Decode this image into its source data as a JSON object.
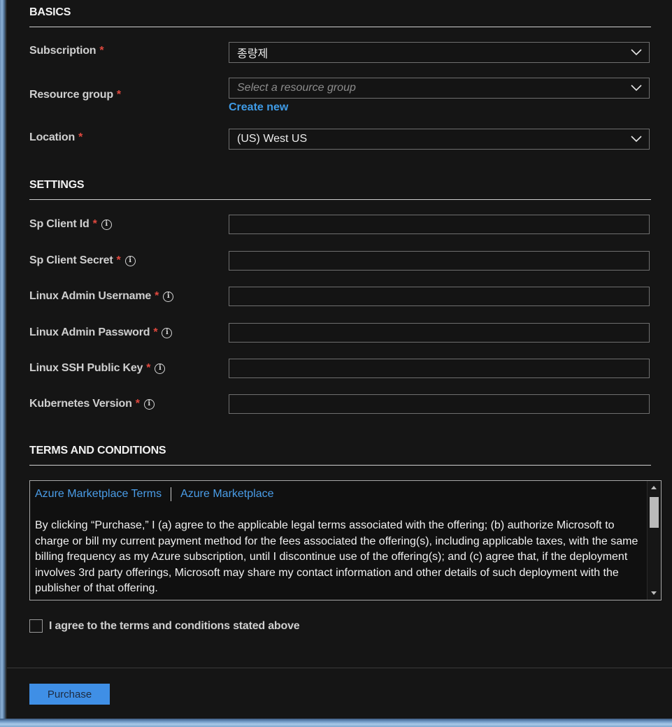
{
  "basics": {
    "title": "BASICS",
    "subscription": {
      "label": "Subscription",
      "value": "종량제"
    },
    "resource_group": {
      "label": "Resource group",
      "placeholder": "Select a resource group",
      "create_new": "Create new"
    },
    "location": {
      "label": "Location",
      "value": "(US) West US"
    }
  },
  "settings": {
    "title": "SETTINGS",
    "sp_client_id": {
      "label": "Sp Client Id"
    },
    "sp_client_secret": {
      "label": "Sp Client Secret"
    },
    "linux_admin_username": {
      "label": "Linux Admin Username"
    },
    "linux_admin_password": {
      "label": "Linux Admin Password"
    },
    "linux_ssh_public_key": {
      "label": "Linux SSH Public Key"
    },
    "kubernetes_version": {
      "label": "Kubernetes Version"
    }
  },
  "required_mark": "*",
  "info_glyph": "i",
  "terms": {
    "title": "TERMS AND CONDITIONS",
    "link_1": "Azure Marketplace Terms",
    "link_2": "Azure Marketplace",
    "body": "By clicking “Purchase,” I (a) agree to the applicable legal terms associated with the offering; (b) authorize Microsoft to charge or bill my current payment method for the fees associated the offering(s), including applicable taxes, with the same billing frequency as my Azure subscription, until I discontinue use of the offering(s); and (c) agree that, if the deployment involves 3rd party offerings, Microsoft may share my contact information and other details of such deployment with the publisher of that offering.",
    "agree_label": "I agree to the terms and conditions stated above",
    "agree_checked": false
  },
  "purchase_label": "Purchase",
  "colors": {
    "background": "#151515",
    "accent": "#3f8fe6",
    "link": "#4a9de8",
    "required": "#e0483e"
  }
}
